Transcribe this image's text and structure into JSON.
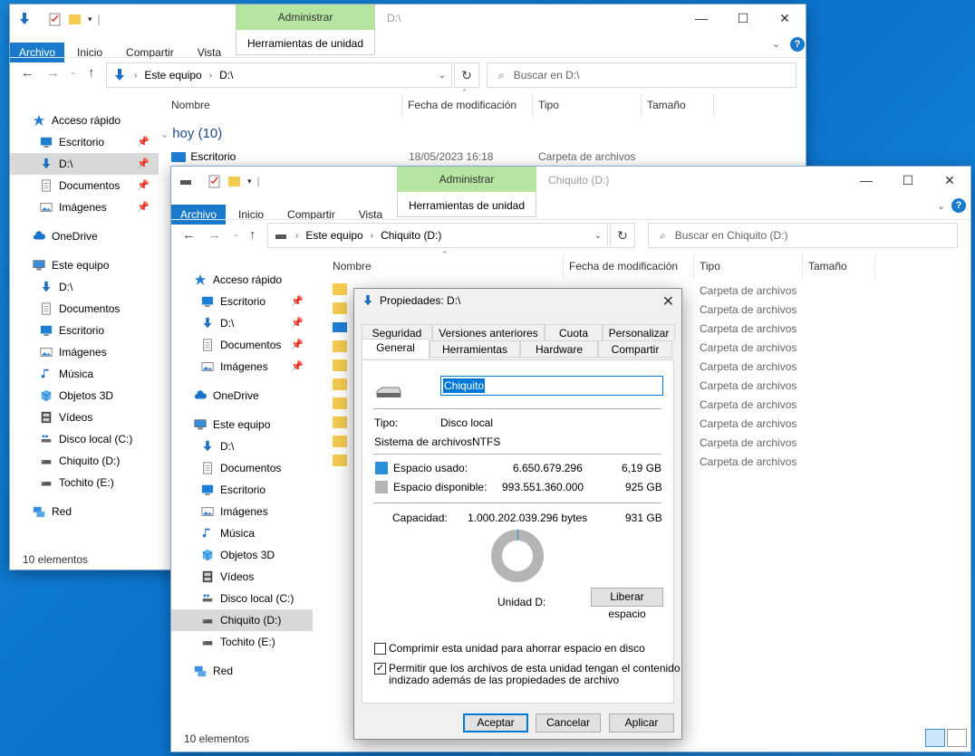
{
  "back_window": {
    "title": "D:\\",
    "context_group": "Administrar",
    "context_tab": "Herramientas de unidad",
    "ribbon_tabs": [
      "Archivo",
      "Inicio",
      "Compartir",
      "Vista"
    ],
    "address": {
      "crumbs": [
        "Este equipo",
        "D:\\"
      ]
    },
    "search_placeholder": "Buscar en D:\\",
    "columns": [
      "Nombre",
      "Fecha de modificación",
      "Tipo",
      "Tamaño"
    ],
    "group_header": "hoy (10)",
    "rows": [
      {
        "name": "Escritorio",
        "date": "18/05/2023 16:18",
        "type": "Carpeta de archivos"
      }
    ],
    "nav": [
      {
        "label": "Acceso rápido",
        "icon": "star-icon",
        "level": 0,
        "pin": false
      },
      {
        "label": "Escritorio",
        "icon": "desktop-icon",
        "level": 1,
        "pin": true
      },
      {
        "label": "D:\\",
        "icon": "download-arrow-icon",
        "level": 1,
        "pin": true,
        "selected": true
      },
      {
        "label": "Documentos",
        "icon": "document-icon",
        "level": 1,
        "pin": true
      },
      {
        "label": "Imágenes",
        "icon": "pictures-icon",
        "level": 1,
        "pin": true
      },
      {
        "label": "OneDrive",
        "icon": "cloud-icon",
        "level": 0,
        "pin": false,
        "gap": true
      },
      {
        "label": "Este equipo",
        "icon": "computer-icon",
        "level": 0,
        "pin": false,
        "gap": true
      },
      {
        "label": "D:\\",
        "icon": "download-arrow-icon",
        "level": 1
      },
      {
        "label": "Documentos",
        "icon": "document-icon",
        "level": 1
      },
      {
        "label": "Escritorio",
        "icon": "desktop-icon",
        "level": 1
      },
      {
        "label": "Imágenes",
        "icon": "pictures-icon",
        "level": 1
      },
      {
        "label": "Música",
        "icon": "music-icon",
        "level": 1
      },
      {
        "label": "Objetos 3D",
        "icon": "cube-icon",
        "level": 1
      },
      {
        "label": "Vídeos",
        "icon": "film-icon",
        "level": 1
      },
      {
        "label": "Disco local (C:)",
        "icon": "windows-drive-icon",
        "level": 1
      },
      {
        "label": "Chiquito (D:)",
        "icon": "drive-icon",
        "level": 1
      },
      {
        "label": "Tochito (E:)",
        "icon": "drive-icon",
        "level": 1
      },
      {
        "label": "Red",
        "icon": "network-icon",
        "level": 0,
        "gap": true
      }
    ],
    "status": "10 elementos"
  },
  "front_window": {
    "title": "Chiquito (D:)",
    "context_group": "Administrar",
    "context_tab": "Herramientas de unidad",
    "ribbon_tabs": [
      "Archivo",
      "Inicio",
      "Compartir",
      "Vista"
    ],
    "address": {
      "crumbs": [
        "Este equipo",
        "Chiquito (D:)"
      ]
    },
    "search_placeholder": "Buscar en Chiquito (D:)",
    "columns": [
      "Nombre",
      "Fecha de modificación",
      "Tipo",
      "Tamaño"
    ],
    "row_type": "Carpeta de archivos",
    "row_count": 10,
    "nav": [
      {
        "label": "Acceso rápido",
        "icon": "star-icon",
        "level": 0,
        "pin": false
      },
      {
        "label": "Escritorio",
        "icon": "desktop-icon",
        "level": 1,
        "pin": true
      },
      {
        "label": "D:\\",
        "icon": "download-arrow-icon",
        "level": 1,
        "pin": true
      },
      {
        "label": "Documentos",
        "icon": "document-icon",
        "level": 1,
        "pin": true
      },
      {
        "label": "Imágenes",
        "icon": "pictures-icon",
        "level": 1,
        "pin": true
      },
      {
        "label": "OneDrive",
        "icon": "cloud-icon",
        "level": 0,
        "gap": true
      },
      {
        "label": "Este equipo",
        "icon": "computer-icon",
        "level": 0,
        "gap": true
      },
      {
        "label": "D:\\",
        "icon": "download-arrow-icon",
        "level": 1
      },
      {
        "label": "Documentos",
        "icon": "document-icon",
        "level": 1
      },
      {
        "label": "Escritorio",
        "icon": "desktop-icon",
        "level": 1
      },
      {
        "label": "Imágenes",
        "icon": "pictures-icon",
        "level": 1
      },
      {
        "label": "Música",
        "icon": "music-icon",
        "level": 1
      },
      {
        "label": "Objetos 3D",
        "icon": "cube-icon",
        "level": 1
      },
      {
        "label": "Vídeos",
        "icon": "film-icon",
        "level": 1
      },
      {
        "label": "Disco local (C:)",
        "icon": "windows-drive-icon",
        "level": 1
      },
      {
        "label": "Chiquito (D:)",
        "icon": "drive-icon",
        "level": 1,
        "selected": true
      },
      {
        "label": "Tochito (E:)",
        "icon": "drive-icon",
        "level": 1
      },
      {
        "label": "Red",
        "icon": "network-icon",
        "level": 0,
        "gap": true
      }
    ],
    "status": "10 elementos"
  },
  "dialog": {
    "title": "Propiedades: D:\\",
    "tabs_row1": [
      "Seguridad",
      "Versiones anteriores",
      "Cuota",
      "Personalizar"
    ],
    "tabs_row2": [
      "General",
      "Herramientas",
      "Hardware",
      "Compartir"
    ],
    "active_tab": "General",
    "name_value": "Chiquito",
    "type_label": "Tipo:",
    "type_value": "Disco local",
    "fs_label": "Sistema de archivos:",
    "fs_value": "NTFS",
    "used_label": "Espacio usado:",
    "used_bytes": "6.650.679.296",
    "used_gb": "6,19 GB",
    "free_label": "Espacio disponible:",
    "free_bytes": "993.551.360.000",
    "free_gb": "925 GB",
    "cap_label": "Capacidad:",
    "cap_bytes": "1.000.202.039.296 bytes",
    "cap_gb": "931 GB",
    "used_fraction": 0.0066,
    "used_color": "#2b8fd6",
    "free_color": "#b4b4b4",
    "drive_label": "Unidad D:",
    "liberar": "Liberar espacio",
    "compress_label": "Comprimir esta unidad para ahorrar espacio en disco",
    "compress_checked": false,
    "index_label_1": "Permitir que los archivos de esta unidad tengan el contenido",
    "index_label_2": "indizado además de las propiedades de archivo",
    "index_checked": true,
    "ok": "Aceptar",
    "cancel": "Cancelar",
    "apply": "Aplicar"
  }
}
